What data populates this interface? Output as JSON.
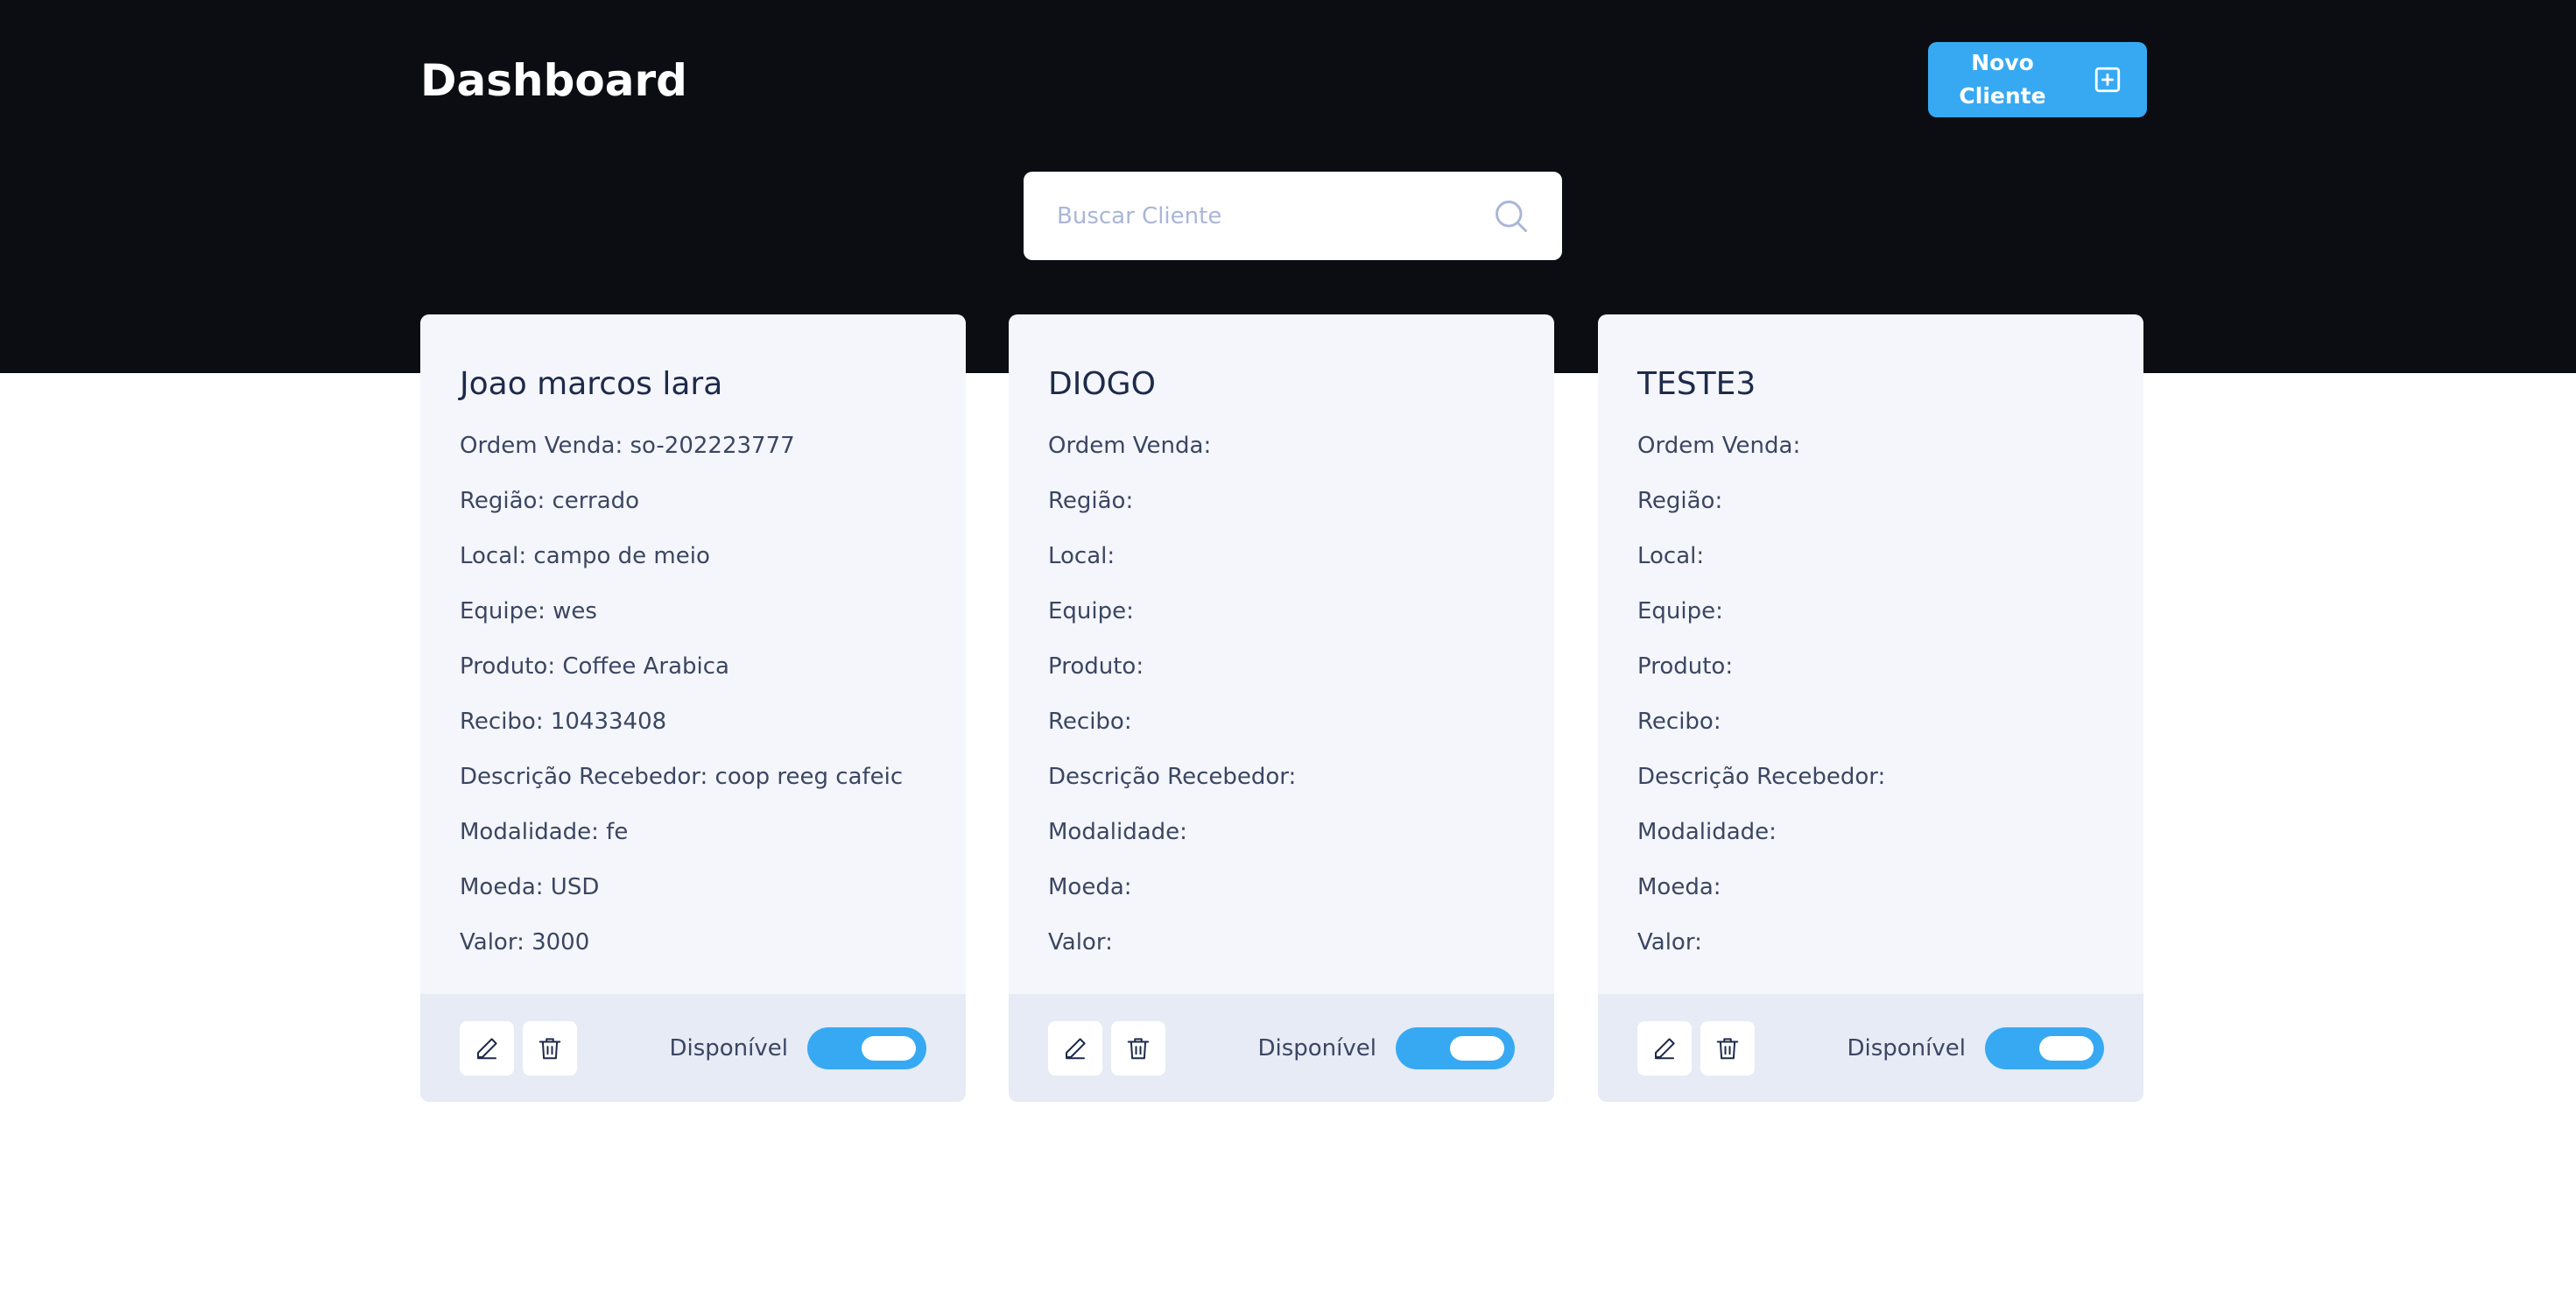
{
  "header": {
    "title": "Dashboard",
    "new_client_label": "Novo Cliente"
  },
  "search": {
    "placeholder": "Buscar Cliente",
    "value": ""
  },
  "colors": {
    "header_bg": "#0b0d12",
    "accent": "#37a9f3",
    "card_bg": "#f4f6fb",
    "card_footer_bg": "#e6ebf5",
    "text_dark": "#1e2a4a",
    "text_body": "#3b4662"
  },
  "icons": {
    "new_client": "plus-square-icon",
    "search": "search-icon",
    "edit": "pencil-icon",
    "delete": "trash-icon"
  },
  "clients": [
    {
      "name": "Joao marcos lara",
      "fields": [
        "Ordem Venda: so-202223777",
        "Região: cerrado",
        "Local: campo de meio",
        "Equipe: wes",
        "Produto: Coffee Arabica",
        "Recibo: 10433408",
        "Descrição Recebedor: coop reeg cafeic",
        "Modalidade: fe",
        "Moeda: USD",
        "Valor: 3000"
      ],
      "status_label": "Disponível",
      "available": true
    },
    {
      "name": "DIOGO",
      "fields": [
        "Ordem Venda:",
        "Região:",
        "Local:",
        "Equipe:",
        "Produto:",
        "Recibo:",
        "Descrição Recebedor:",
        "Modalidade:",
        "Moeda:",
        "Valor:"
      ],
      "status_label": "Disponível",
      "available": true
    },
    {
      "name": "TESTE3",
      "fields": [
        "Ordem Venda:",
        "Região:",
        "Local:",
        "Equipe:",
        "Produto:",
        "Recibo:",
        "Descrição Recebedor:",
        "Modalidade:",
        "Moeda:",
        "Valor:"
      ],
      "status_label": "Disponível",
      "available": true
    }
  ]
}
